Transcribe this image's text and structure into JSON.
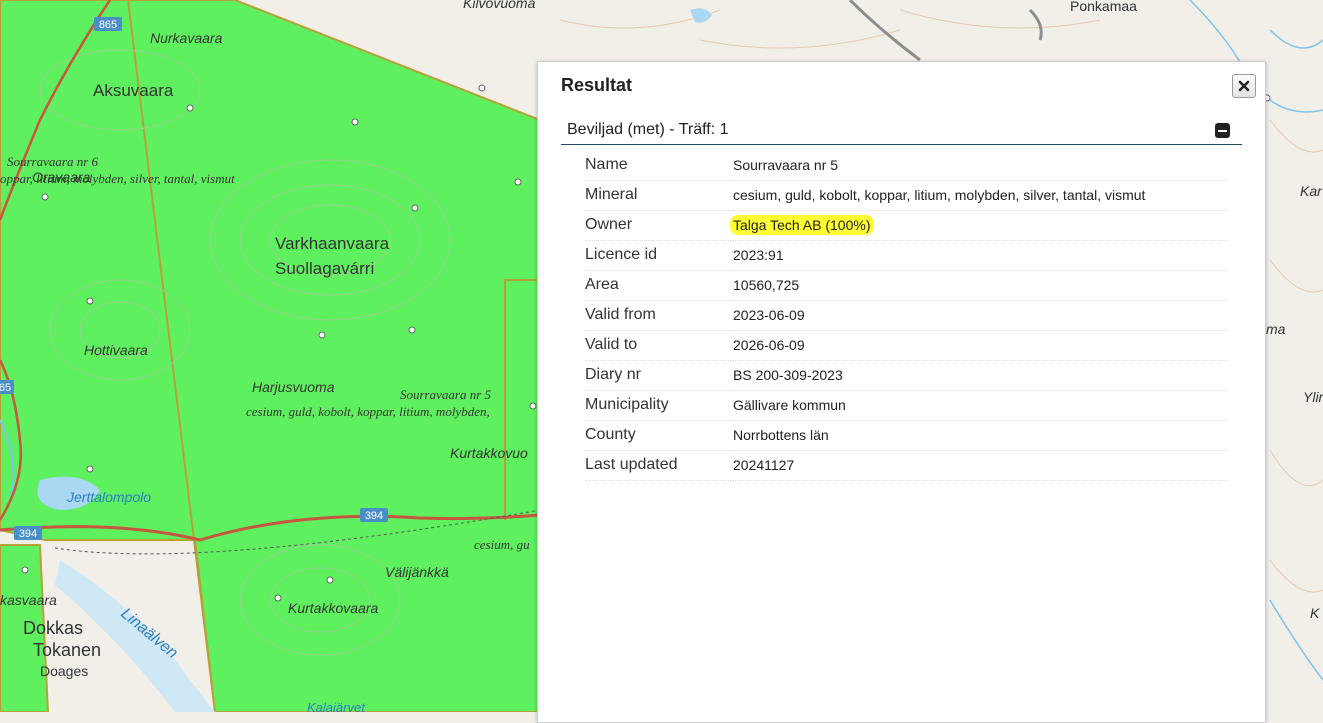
{
  "map": {
    "place_labels": {
      "kilvovuoma": "Kilvovuoma",
      "ponkamaa": "Ponkamaa",
      "nurkavaara": "Nurkavaara",
      "aksuvaara": "Aksuvaara",
      "oravaara": "Oravaara",
      "varkhaanvaara": "Varkhaanvaara",
      "suollagavarri": "Suollagavárri",
      "hottivaara": "Hottivaara",
      "harjusvuoma": "Harjusvuoma",
      "kurtakkovuo": "Kurtakkovuo",
      "jerttalompolo": "Jerttalompolo",
      "valijankka": "Välijänkkä",
      "kurtakkovaara": "Kurtakkovaara",
      "kasvaara": "kasvaara",
      "dokkas": "Dokkas",
      "tokanen": "Tokanen",
      "doages": "Doages",
      "linaalven": "Linaälven",
      "kalajarvet": "Kalajärvet",
      "ka_right": "Kar",
      "ma_right": "ma",
      "yli_right": "Ylir",
      "k_right": "K"
    },
    "claim_labels": {
      "sourravaara6_name": "Sourravaara nr 6",
      "sourravaara6_minerals": "oppar, litium, molybden, silver, tantal, vismut",
      "sourravaara5_name": "Sourravaara nr 5",
      "sourravaara5_minerals": "cesium, guld, kobolt, koppar, litium, molybden,",
      "cesium_short": "cesium, gu"
    },
    "road_shields": {
      "r865": "865",
      "r394a": "394",
      "r394b": "394",
      "r65": "65"
    }
  },
  "panel": {
    "title": "Resultat",
    "group_title": "Beviljad (met) - Träff: 1",
    "rows": [
      {
        "key": "Name",
        "value": "Sourravaara nr 5"
      },
      {
        "key": "Mineral",
        "value": "cesium, guld, kobolt, koppar, litium, molybden, silver, tantal, vismut"
      },
      {
        "key": "Owner",
        "value": "Talga Tech AB (100%)"
      },
      {
        "key": "Licence id",
        "value": "2023:91"
      },
      {
        "key": "Area",
        "value": "10560,725"
      },
      {
        "key": "Valid from",
        "value": "2023-06-09"
      },
      {
        "key": "Valid to",
        "value": "2026-06-09"
      },
      {
        "key": "Diary nr",
        "value": "BS 200-309-2023"
      },
      {
        "key": "Municipality",
        "value": "Gällivare kommun"
      },
      {
        "key": "County",
        "value": "Norrbottens län"
      },
      {
        "key": "Last updated",
        "value": "20241127"
      }
    ]
  },
  "colors": {
    "claim_fill": "#5ef05e",
    "claim_border": "#b8a038",
    "road": "#c8553d",
    "water": "#7fc4ea",
    "highlight": "#ffff33"
  }
}
